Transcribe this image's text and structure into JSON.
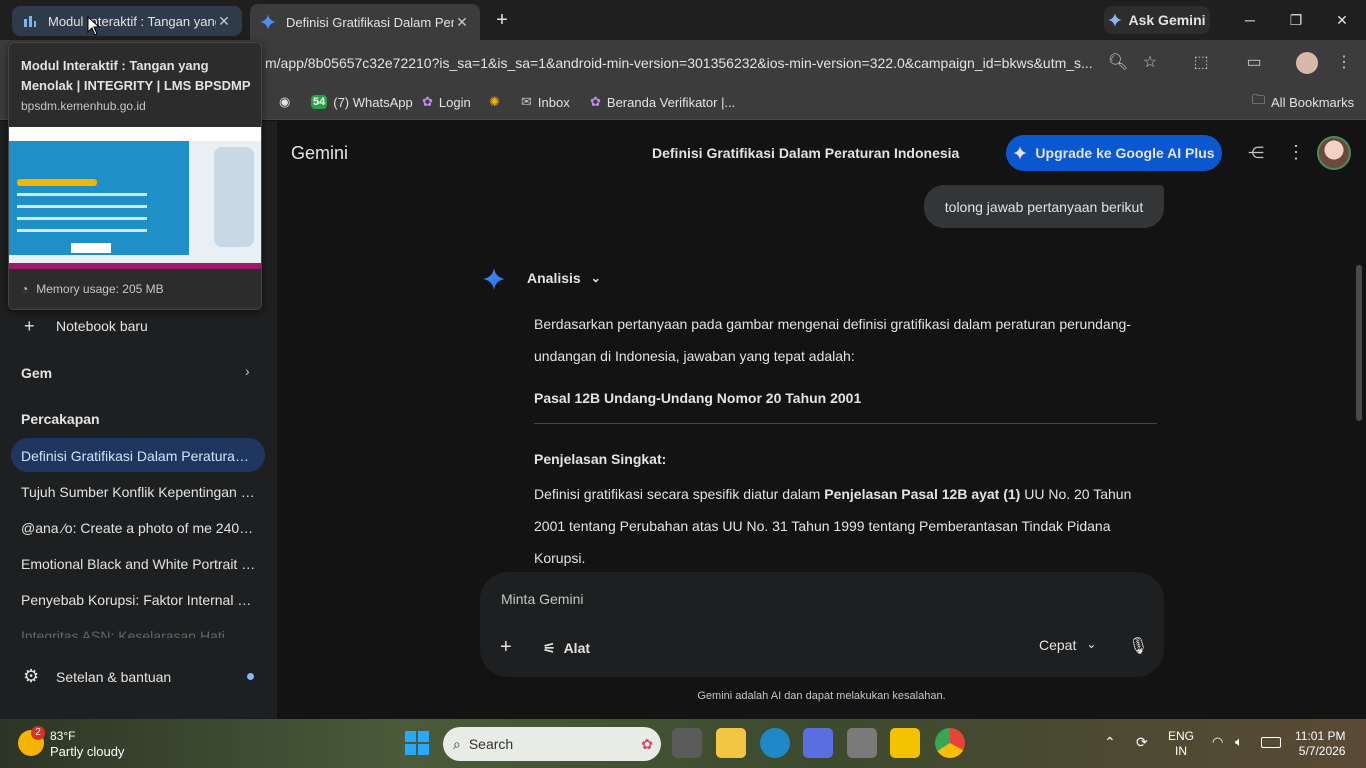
{
  "tabs": [
    {
      "label": "Modul Interaktif : Tangan yang Menolak"
    },
    {
      "label": "Definisi Gratifikasi Dalam Peraturan Indonesia"
    }
  ],
  "ask_gemini": "Ask Gemini",
  "address_bar": {
    "url": "m/app/8b05657c32e72210?is_sa=1&is_sa=1&android-min-version=301356232&ios-min-version=322.0&campaign_id=bkws&utm_s..."
  },
  "bookmarks": {
    "items": [
      "(7) WhatsApp",
      "Login",
      "Inbox",
      "Beranda Verifikator |..."
    ],
    "whatsapp_badge": "54",
    "all": "All Bookmarks"
  },
  "hover_card": {
    "title": "Modul Interaktif : Tangan yang Menolak | INTEGRITY | LMS BPSDMP",
    "domain": "bpsdm.kemenhub.go.id",
    "memory": "Memory usage: 205 MB"
  },
  "sidebar": {
    "notebook": "Notebook baru",
    "gem": "Gem",
    "section": "Percakapan",
    "items": [
      "Definisi Gratifikasi Dalam Peraturan I...",
      "Tujuh Sumber Konflik Kepentingan Pe...",
      "@ana ⁄o: Create a photo of me 240 le...",
      "Emotional Black and White Portrait Cr...",
      "Penyebab Korupsi: Faktor Internal da...",
      "Integritas ASN: Keselarasan Hati, Uca..."
    ],
    "settings": "Setelan & bantuan"
  },
  "header": {
    "brand": "Gemini",
    "title": "Definisi Gratifikasi Dalam Peraturan Indonesia",
    "upgrade": "Upgrade ke Google AI Plus"
  },
  "chat": {
    "user_message": "tolong jawab pertanyaan berikut",
    "analysis_label": "Analisis",
    "intro": "Berdasarkan pertanyaan pada gambar mengenai definisi gratifikasi dalam peraturan perundang-undangan di Indonesia, jawaban yang tepat adalah:",
    "answer": "Pasal 12B Undang-Undang Nomor 20 Tahun 2001",
    "heading": "Penjelasan Singkat:",
    "expl_a": "Definisi gratifikasi secara spesifik diatur dalam ",
    "expl_bold": "Penjelasan Pasal 12B ayat (1)",
    "expl_b": " UU No. 20 Tahun 2001 tentang Perubahan atas UU No. 31 Tahun 1999 tentang Pemberantasan Tindak Pidana Korupsi."
  },
  "composer": {
    "placeholder": "Minta Gemini",
    "tools": "Alat",
    "mode": "Cepat",
    "disclaimer": "Gemini adalah AI dan dapat melakukan kesalahan."
  },
  "taskbar": {
    "temp": "83°F",
    "weather": "Partly cloudy",
    "weather_badge": "2",
    "search": "Search",
    "lang_top": "ENG",
    "lang_bottom": "IN",
    "time": "11:01 PM",
    "date": "5/7/2026"
  },
  "colors": {
    "accent": "#0b57d0",
    "active_item": "#1f3760",
    "background": "#131314"
  }
}
